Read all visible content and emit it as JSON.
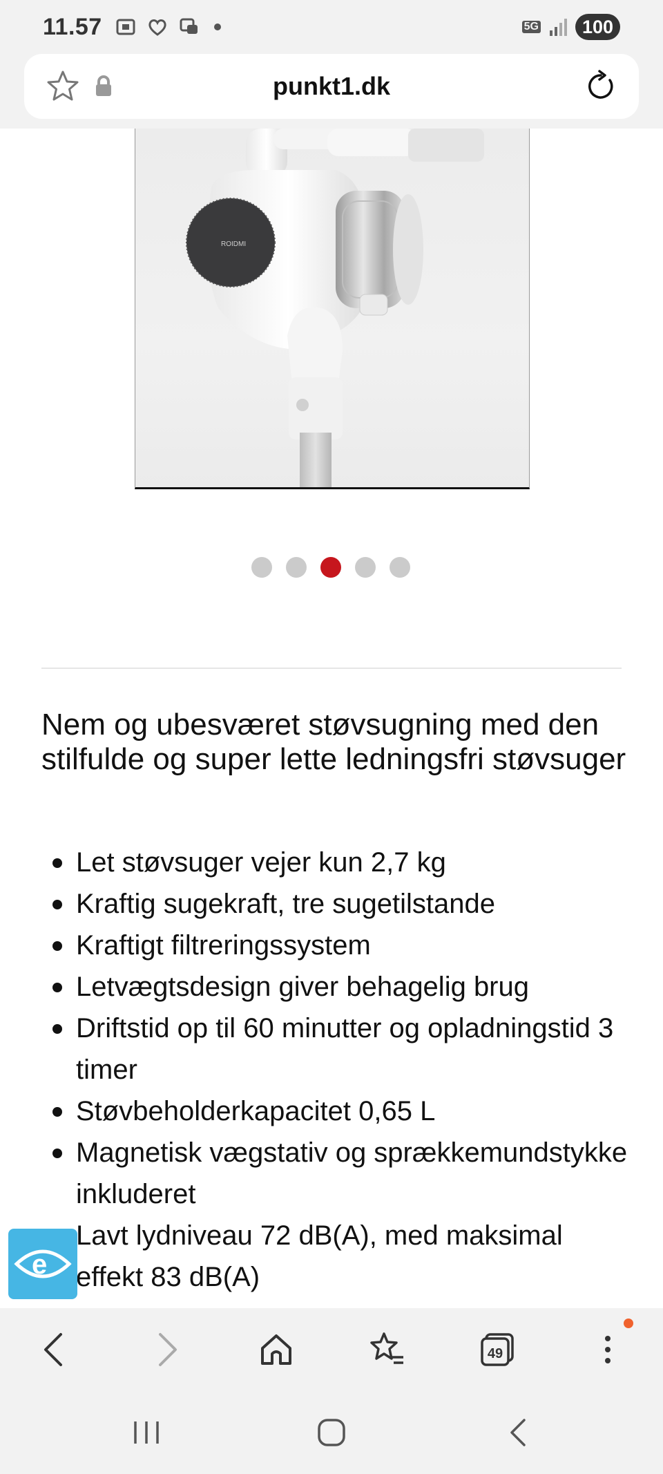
{
  "status_bar": {
    "time": "11.57",
    "network": "5G",
    "battery": "100"
  },
  "url_bar": {
    "domain": "punkt1.dk"
  },
  "product_image": {
    "brand_text": "ROIDMI"
  },
  "carousel": {
    "total": 5,
    "active_index": 2
  },
  "description": {
    "headline": "Nem og ubesværet støvsugning med den stilfulde og super lette ledningsfri støvsuger",
    "features": [
      "Let støvsuger vejer kun 2,7 kg",
      "Kraftig sugekraft, tre sugetilstande",
      "Kraftigt filtreringssystem",
      "Letvægtsdesign giver behagelig brug",
      "Driftstid op til 60 minutter og opladningstid 3 timer",
      "Støvbeholderkapacitet 0,65 L",
      "Magnetisk vægstativ og sprækkemundstykke inkluderet",
      "Lavt lydniveau 72 dB(A), med maksimal effekt 83 dB(A)"
    ]
  },
  "browser_toolbar": {
    "tab_count": "49"
  },
  "colors": {
    "accent_red": "#c6161d",
    "dot_inactive": "#cbcbcb",
    "accessibility_blue": "#46b6e4",
    "notification_orange": "#f0622d",
    "chrome_bg": "#f2f2f2"
  },
  "icons": {
    "status_left": [
      "screenshot-icon",
      "health-icon",
      "messages-icon"
    ],
    "url_bar": [
      "bookmark-star-icon",
      "lock-icon",
      "reload-icon"
    ],
    "toolbar": [
      "back-arrow-icon",
      "forward-arrow-icon",
      "home-icon",
      "bookmarks-icon",
      "tabs-icon",
      "more-menu-icon"
    ],
    "nav": [
      "recents-icon",
      "home-button-icon",
      "back-icon"
    ],
    "accessibility": "accessibility-eye-icon"
  }
}
